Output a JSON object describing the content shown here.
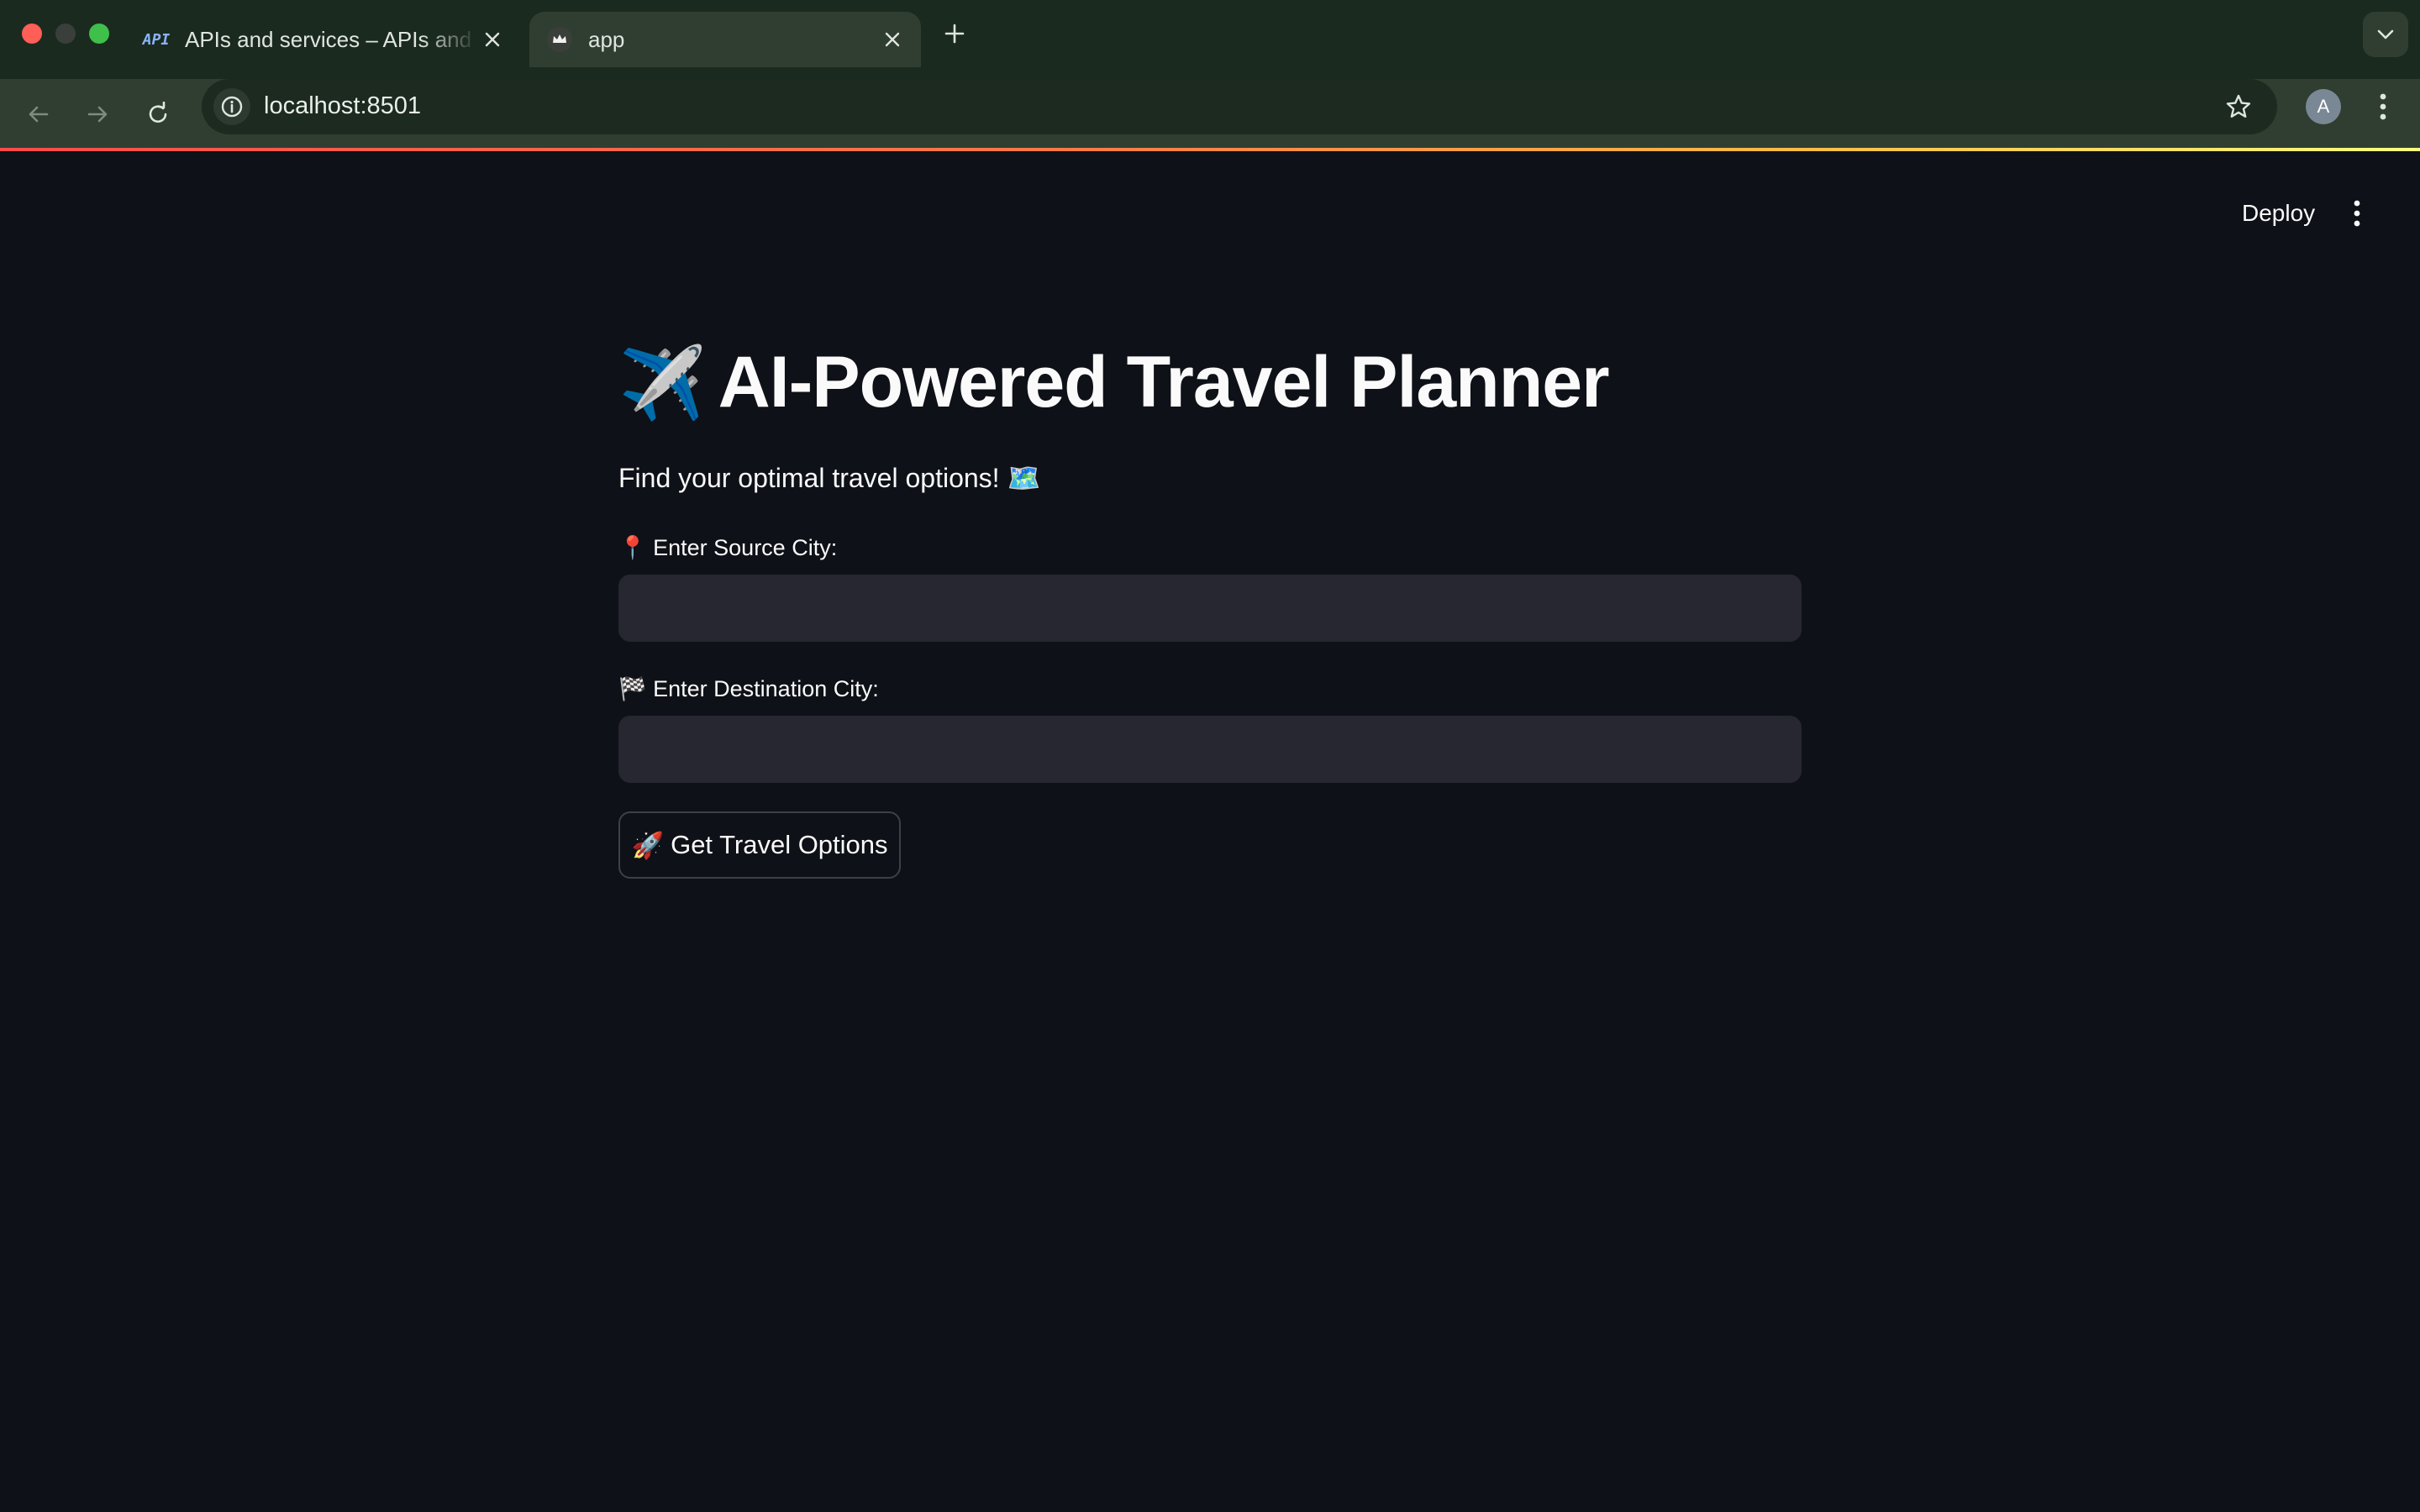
{
  "browser": {
    "tabs": [
      {
        "title": "APIs and services – APIs and services",
        "favicon_text": "API",
        "favicon": "api-icon",
        "active": false
      },
      {
        "title": "app",
        "favicon": "streamlit-crown-icon",
        "active": true
      }
    ],
    "url": "localhost:8501",
    "profile_initial": "A"
  },
  "app": {
    "header": {
      "deploy_label": "Deploy"
    },
    "title_emoji": "✈️",
    "title_text": "AI-Powered Travel Planner",
    "subtitle": "Find your optimal travel options! 🗺️",
    "source_label": "📍 Enter Source City:",
    "source_value": "",
    "destination_label": "🏁 Enter Destination City:",
    "destination_value": "",
    "submit_emoji": "🚀",
    "submit_label": "Get Travel Options"
  },
  "colors": {
    "app_bg": "#0e1117",
    "input_bg": "#262730",
    "text": "#fafafa",
    "chrome_bg": "#1b2a1f",
    "chrome_toolbar": "#2f3e31"
  }
}
